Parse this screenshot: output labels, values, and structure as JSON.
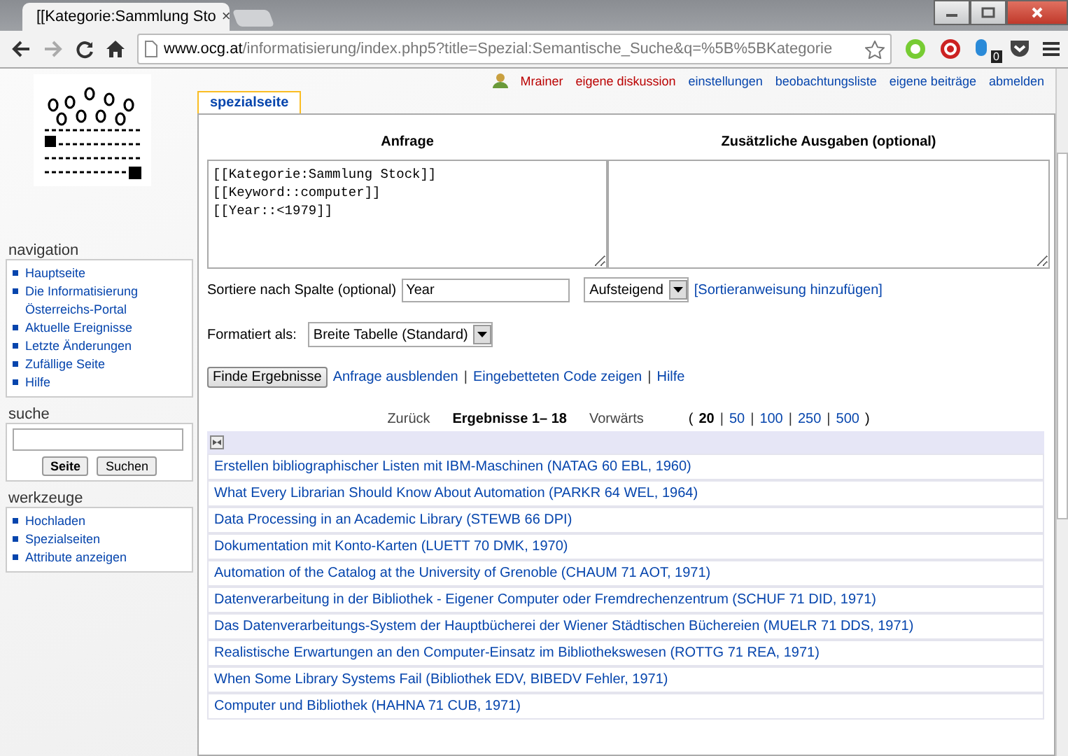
{
  "browser": {
    "tab_title": "[[Kategorie:Sammlung Sto",
    "tab_close": "×",
    "url_host": "www.ocg.at",
    "url_path": "/informatisierung/index.php5?title=Spezial:Semantische_Suche&q=%5B%5BKategorie",
    "extension_badge": "0"
  },
  "user_links": [
    {
      "label": "Mrainer",
      "kind": "user"
    },
    {
      "label": "eigene diskussion",
      "kind": "new"
    },
    {
      "label": "einstellungen",
      "kind": "link"
    },
    {
      "label": "beobachtungsliste",
      "kind": "link"
    },
    {
      "label": "eigene beiträge",
      "kind": "link"
    },
    {
      "label": "abmelden",
      "kind": "link"
    }
  ],
  "page_tab": "spezialseite",
  "sidebar": {
    "sections": [
      {
        "title": "navigation",
        "kind": "links",
        "items": [
          "Hauptseite",
          "Die Informatisierung Österreichs-Portal",
          "Aktuelle Ereignisse",
          "Letzte Änderungen",
          "Zufällige Seite",
          "Hilfe"
        ]
      },
      {
        "title": "suche",
        "kind": "search",
        "buttons": [
          "Seite",
          "Suchen"
        ]
      },
      {
        "title": "werkzeuge",
        "kind": "links",
        "items": [
          "Hochladen",
          "Spezialseiten",
          "Attribute anzeigen"
        ]
      }
    ]
  },
  "query": {
    "heading": "Anfrage",
    "value": "[[Kategorie:Sammlung Stock]]\n[[Keyword::computer]]\n[[Year::<1979]]"
  },
  "extra": {
    "heading": "Zusätzliche Ausgaben (optional)"
  },
  "sort": {
    "label": "Sortiere nach Spalte (optional)",
    "value": "Year",
    "order": "Aufsteigend",
    "add_link": "[Sortieranweisung hinzufügen]"
  },
  "format": {
    "label": "Formatiert als:",
    "value": "Breite Tabelle (Standard)"
  },
  "actions": {
    "button": "Finde Ergebnisse",
    "separator": "|",
    "links": [
      "Anfrage ausblenden",
      "Eingebetteten Code zeigen",
      "Hilfe"
    ]
  },
  "pager": {
    "back": "Zurück",
    "range": "Ergebnisse 1– 18",
    "forward": "Vorwärts",
    "open": "(",
    "close": ")",
    "separator": "|",
    "sizes": [
      {
        "label": "20",
        "selected": true
      },
      {
        "label": "50",
        "selected": false
      },
      {
        "label": "100",
        "selected": false
      },
      {
        "label": "250",
        "selected": false
      },
      {
        "label": "500",
        "selected": false
      }
    ]
  },
  "results": [
    "Erstellen bibliographischer Listen mit IBM-Maschinen (NATAG 60 EBL, 1960)",
    "What Every Librarian Should Know About Automation (PARKR 64 WEL, 1964)",
    "Data Processing in an Academic Library (STEWB 66 DPI)",
    "Dokumentation mit Konto-Karten (LUETT 70 DMK, 1970)",
    "Automation of the Catalog at the University of Grenoble (CHAUM 71 AOT, 1971)",
    "Datenverarbeitung in der Bibliothek - Eigener Computer oder Fremdrechenzentrum (SCHUF 71 DID, 1971)",
    "Das Datenverarbeitungs-System der Hauptbücherei der Wiener Städtischen Büchereien (MUELR 71 DDS, 1971)",
    "Realistische Erwartungen an den Computer-Einsatz im Bibliothekswesen (ROTTG 71 REA, 1971)",
    "When Some Library Systems Fail (Bibliothek EDV, BIBEDV Fehler, 1971)",
    "Computer und Bibliothek (HAHNA 71 CUB, 1971)"
  ]
}
